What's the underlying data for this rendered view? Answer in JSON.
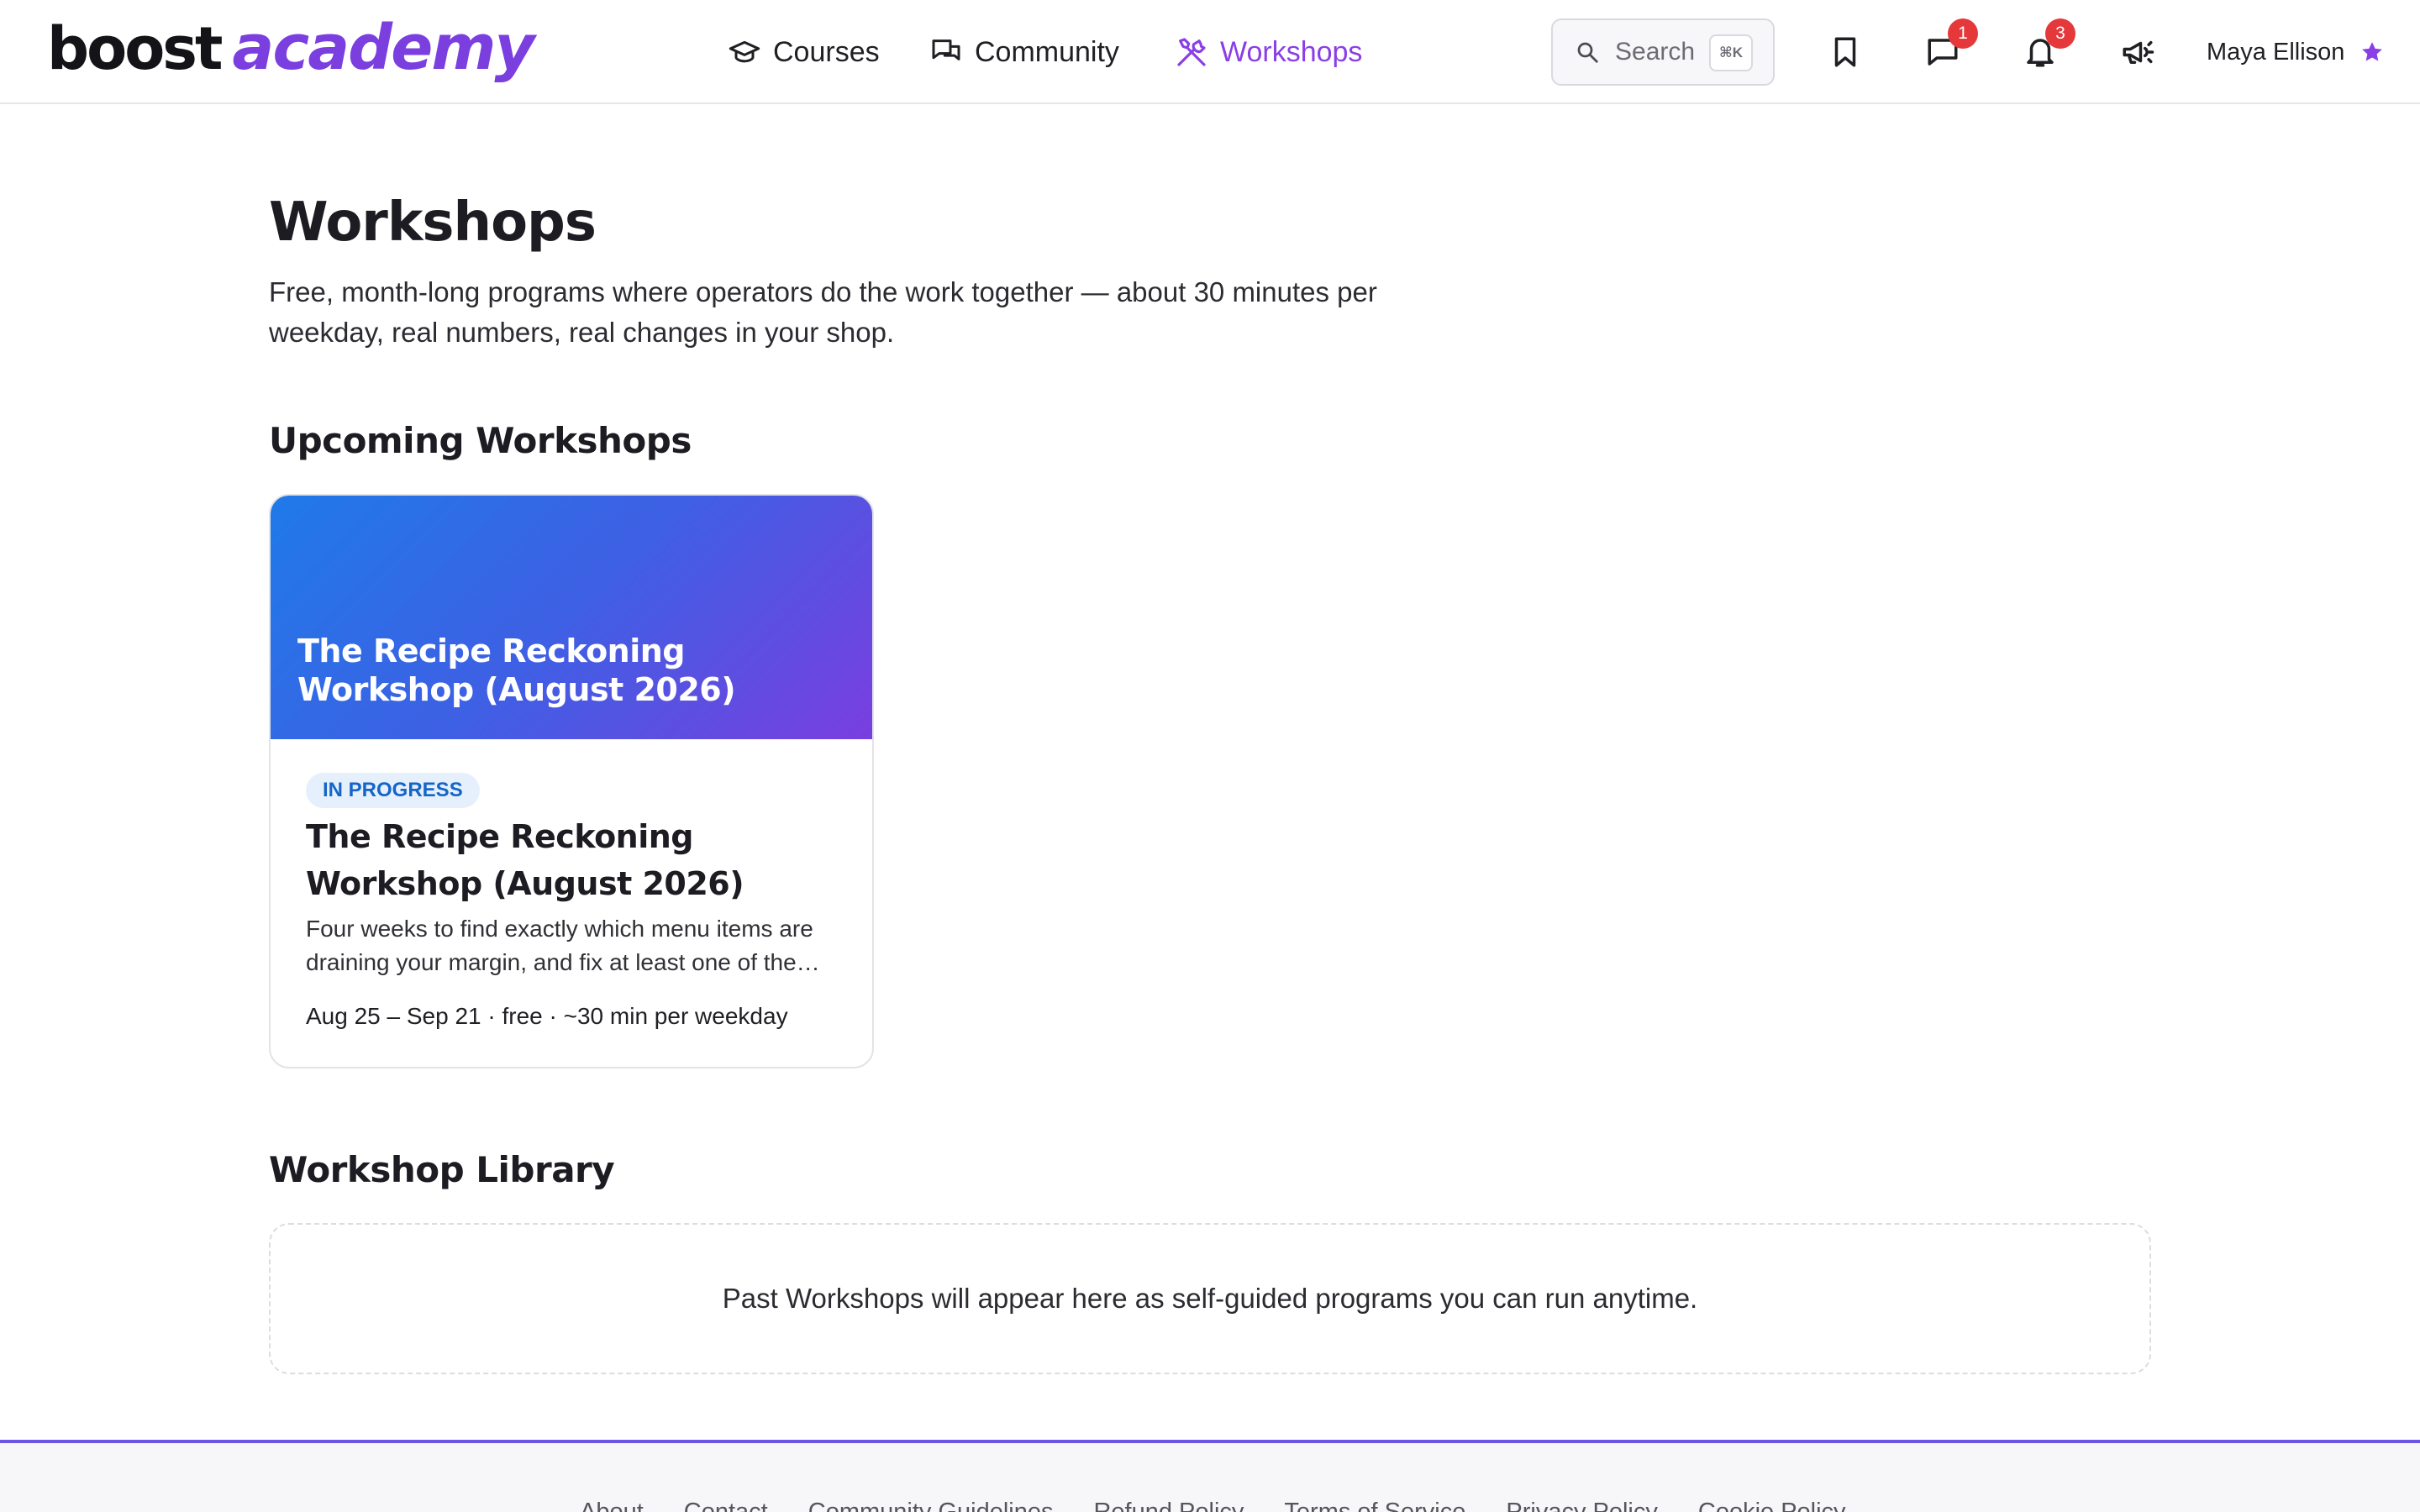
{
  "brand": {
    "part1": "boost",
    "part2": "academy",
    "accent_color": "#8a3ee6"
  },
  "nav": {
    "items": [
      {
        "label": "Courses",
        "icon": "graduation-cap-icon",
        "active": false
      },
      {
        "label": "Community",
        "icon": "chat-bubbles-icon",
        "active": false
      },
      {
        "label": "Workshops",
        "icon": "tools-icon",
        "active": true
      }
    ]
  },
  "search": {
    "label": "Search",
    "shortcut": "⌘K"
  },
  "toolbar": {
    "bookmark_icon": "bookmark-icon",
    "messages": {
      "icon": "message-icon",
      "badge": "1"
    },
    "notifications": {
      "icon": "bell-icon",
      "badge": "3"
    },
    "announcements_icon": "megaphone-icon",
    "badge_color": "#e5383b"
  },
  "user": {
    "name": "Maya Ellison",
    "icon": "star-icon"
  },
  "main": {
    "title": "Workshops",
    "description": "Free, month-long programs where operators do the work together — about 30 minutes per weekday, real numbers, real changes in your shop.",
    "upcoming": {
      "heading": "Upcoming Workshops",
      "cards": [
        {
          "banner_title": "The Recipe Reckoning Workshop (August 2026)",
          "status": "IN PROGRESS",
          "title": "The Recipe Reckoning Workshop (August 2026)",
          "description": "Four weeks to find exactly which menu items are draining your margin, and fix at least one of the…",
          "meta": "Aug 25 – Sep 21 · free · ~30 min per weekday"
        }
      ]
    },
    "library": {
      "heading": "Workshop Library",
      "empty_message": "Past Workshops will appear here as self-guided programs you can run anytime."
    }
  },
  "footer": {
    "links": [
      "About",
      "Contact",
      "Community Guidelines",
      "Refund Policy",
      "Terms of Service",
      "Privacy Policy",
      "Cookie Policy"
    ]
  }
}
